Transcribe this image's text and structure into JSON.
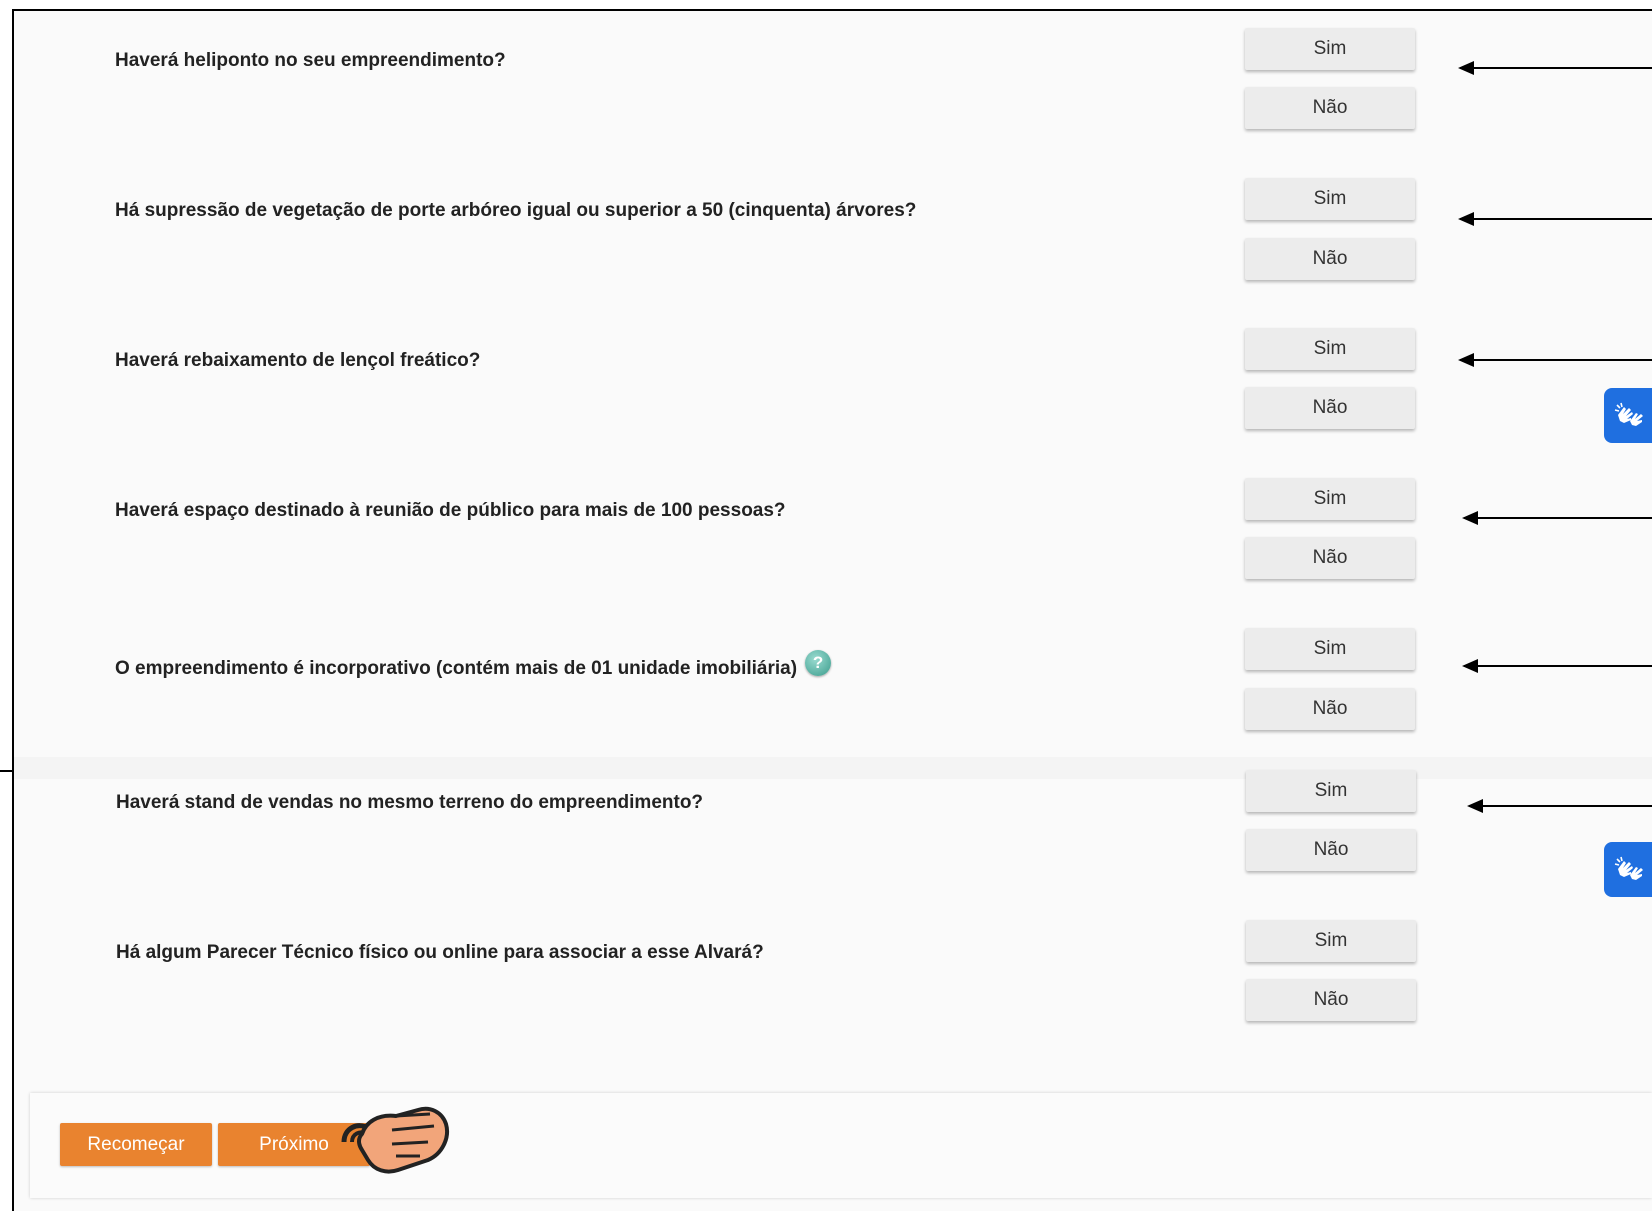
{
  "questions": [
    {
      "text": "Haverá heliponto no seu empreendimento?",
      "yes": "Sim",
      "no": "Não"
    },
    {
      "text": "Há supressão de vegetação de porte arbóreo igual ou superior a 50 (cinquenta) árvores?",
      "yes": "Sim",
      "no": "Não"
    },
    {
      "text": "Haverá rebaixamento de lençol freático?",
      "yes": "Sim",
      "no": "Não"
    },
    {
      "text": "Haverá espaço destinado à reunião de público para mais de 100 pessoas?",
      "yes": "Sim",
      "no": "Não"
    },
    {
      "text": "O empreendimento é incorporativo (contém mais de 01 unidade imobiliária)",
      "yes": "Sim",
      "no": "Não",
      "help_icon": "question-mark-help-icon",
      "help_symbol": "?"
    },
    {
      "text": "Haverá stand de vendas no mesmo terreno do empreendimento?",
      "yes": "Sim",
      "no": "Não"
    },
    {
      "text": "Há algum Parecer Técnico físico ou online para associar a esse Alvará?",
      "yes": "Sim",
      "no": "Não"
    }
  ],
  "footer": {
    "restart_label": "Recomeçar",
    "next_label": "Próximo"
  },
  "accessibility_widget": {
    "icon": "sign-language-hands-icon",
    "color": "#1f6fe0"
  },
  "colors": {
    "action": "#e9832f",
    "option_button": "#ececec",
    "arrow": "#000000"
  }
}
